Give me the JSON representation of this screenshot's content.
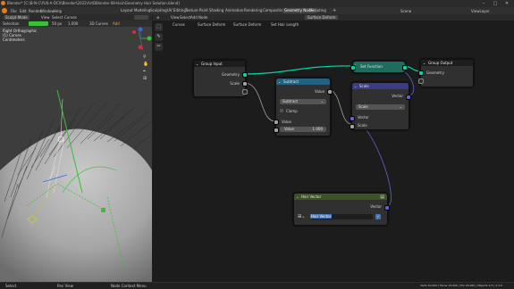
{
  "window": {
    "title": "Blender* [C:\\B-N-C\\YLN-A-DCV\\Blender\\2022\\ArtDBlender-08-Hair\\Geometry Hair Solution.blend]",
    "min": "–",
    "max": "□",
    "close": "✕"
  },
  "menu": [
    "File",
    "Edit",
    "Render",
    "Window",
    "Help"
  ],
  "workspaces": [
    "Layout",
    "Modeling",
    "Sculpting",
    "UV Editing",
    "Texture Paint",
    "Shading",
    "Animation",
    "Rendering",
    "Compositing",
    "Geometry Nodes",
    "Scripting"
  ],
  "active_workspace": "Geometry Nodes",
  "scene": "Scene",
  "view_layer": "ViewLayer",
  "viewport": {
    "mode": "Sculpt Mode",
    "menus": [
      "View",
      "Select",
      "Curves"
    ],
    "view_label": "Right Orthographic",
    "object": "(1) Curves",
    "units": "Centimeters",
    "brush_label": "Selection",
    "radius_label": "Radius",
    "radius": "50 px",
    "strength_label": "Strength",
    "strength": "1.000",
    "falloff": "3D Curves",
    "add_label": "Add"
  },
  "node_editor": {
    "menus": [
      "View",
      "Select",
      "Add",
      "Node"
    ],
    "modifier": "Surface Deform",
    "breadcrumb": [
      "Curves",
      "Surface Deform",
      "Surface Deform",
      "Set Hair Length"
    ],
    "nodes": {
      "group_input": {
        "title": "Group Input",
        "geometry": "Geometry",
        "scale": "Scale"
      },
      "subtract": {
        "title": "Subtract",
        "value_out": "Value",
        "operation": "Subtract",
        "clamp": "Clamp",
        "value_in": "Value",
        "value_field_label": "Value",
        "value_field": "1.000"
      },
      "scale": {
        "title": "Scale",
        "vector_out": "Vector",
        "operation": "Scale",
        "vector_in": "Vector",
        "scale_in": "Scale"
      },
      "set_function": {
        "title": "Set Function"
      },
      "group_output": {
        "title": "Group Output",
        "geometry": "Geometry"
      },
      "hair_vector": {
        "title": "Hair Vector",
        "vector_out": "Vector",
        "attr_name": "Hair Vector"
      }
    }
  },
  "statusbar": {
    "left": "Select",
    "mid": "Pan View",
    "right": "Node Context Menu",
    "info": "Verts 10,000 | Faces 10,000 | Tris 20,000 | Objects 1/3 | 3.3.0"
  },
  "colors": {
    "accent": "#e87d0d",
    "geometry_socket": "#00d6a3",
    "float_socket": "#a1a1a1",
    "vector_socket": "#6363c7",
    "subtract_header": "#246283",
    "scale_header": "#3c3c83",
    "hair_vector_header": "#3b5326",
    "group_header": "#1d1d1d"
  }
}
